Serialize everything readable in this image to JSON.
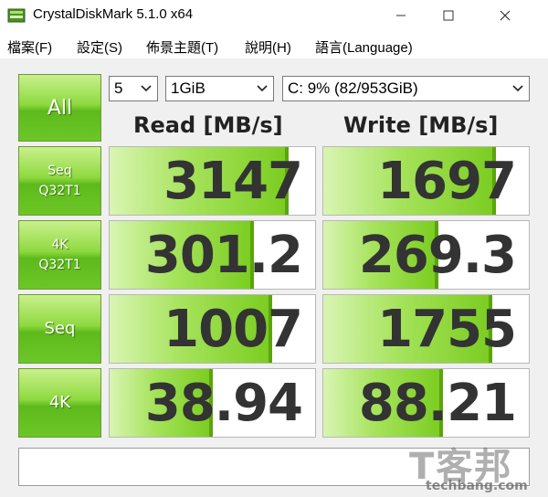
{
  "window": {
    "title": "CrystalDiskMark 5.1.0 x64",
    "icon": "disk-app-icon"
  },
  "menu": [
    {
      "label": "檔案(F)"
    },
    {
      "label": "設定(S)"
    },
    {
      "label": "佈景主題(T)"
    },
    {
      "label": "說明(H)"
    },
    {
      "label": "語言(Language)"
    }
  ],
  "controls": {
    "all_label": "All",
    "count_value": "5",
    "size_value": "1GiB",
    "drive_value": "C: 9% (82/953GiB)"
  },
  "headers": {
    "read": "Read [MB/s]",
    "write": "Write [MB/s]"
  },
  "rows": [
    {
      "label1": "Seq",
      "label2": "Q32T1",
      "read": "3147",
      "write": "1697",
      "read_level": 0.87,
      "write_level": 0.84
    },
    {
      "label1": "4K",
      "label2": "Q32T1",
      "read": "301.2",
      "write": "269.3",
      "read_level": 0.7,
      "write_level": 0.56
    },
    {
      "label1": "Seq",
      "label2": "",
      "read": "1007",
      "write": "1755",
      "read_level": 0.79,
      "write_level": 0.82
    },
    {
      "label1": "4K",
      "label2": "",
      "read": "38.94",
      "write": "88.21",
      "read_level": 0.5,
      "write_level": 0.58
    }
  ],
  "status_text": "",
  "watermark": {
    "big": "T客邦",
    "small": "techbang.com"
  },
  "colors": {
    "accent_green": "#5eba1c",
    "bar_green": "#7ccd22"
  }
}
